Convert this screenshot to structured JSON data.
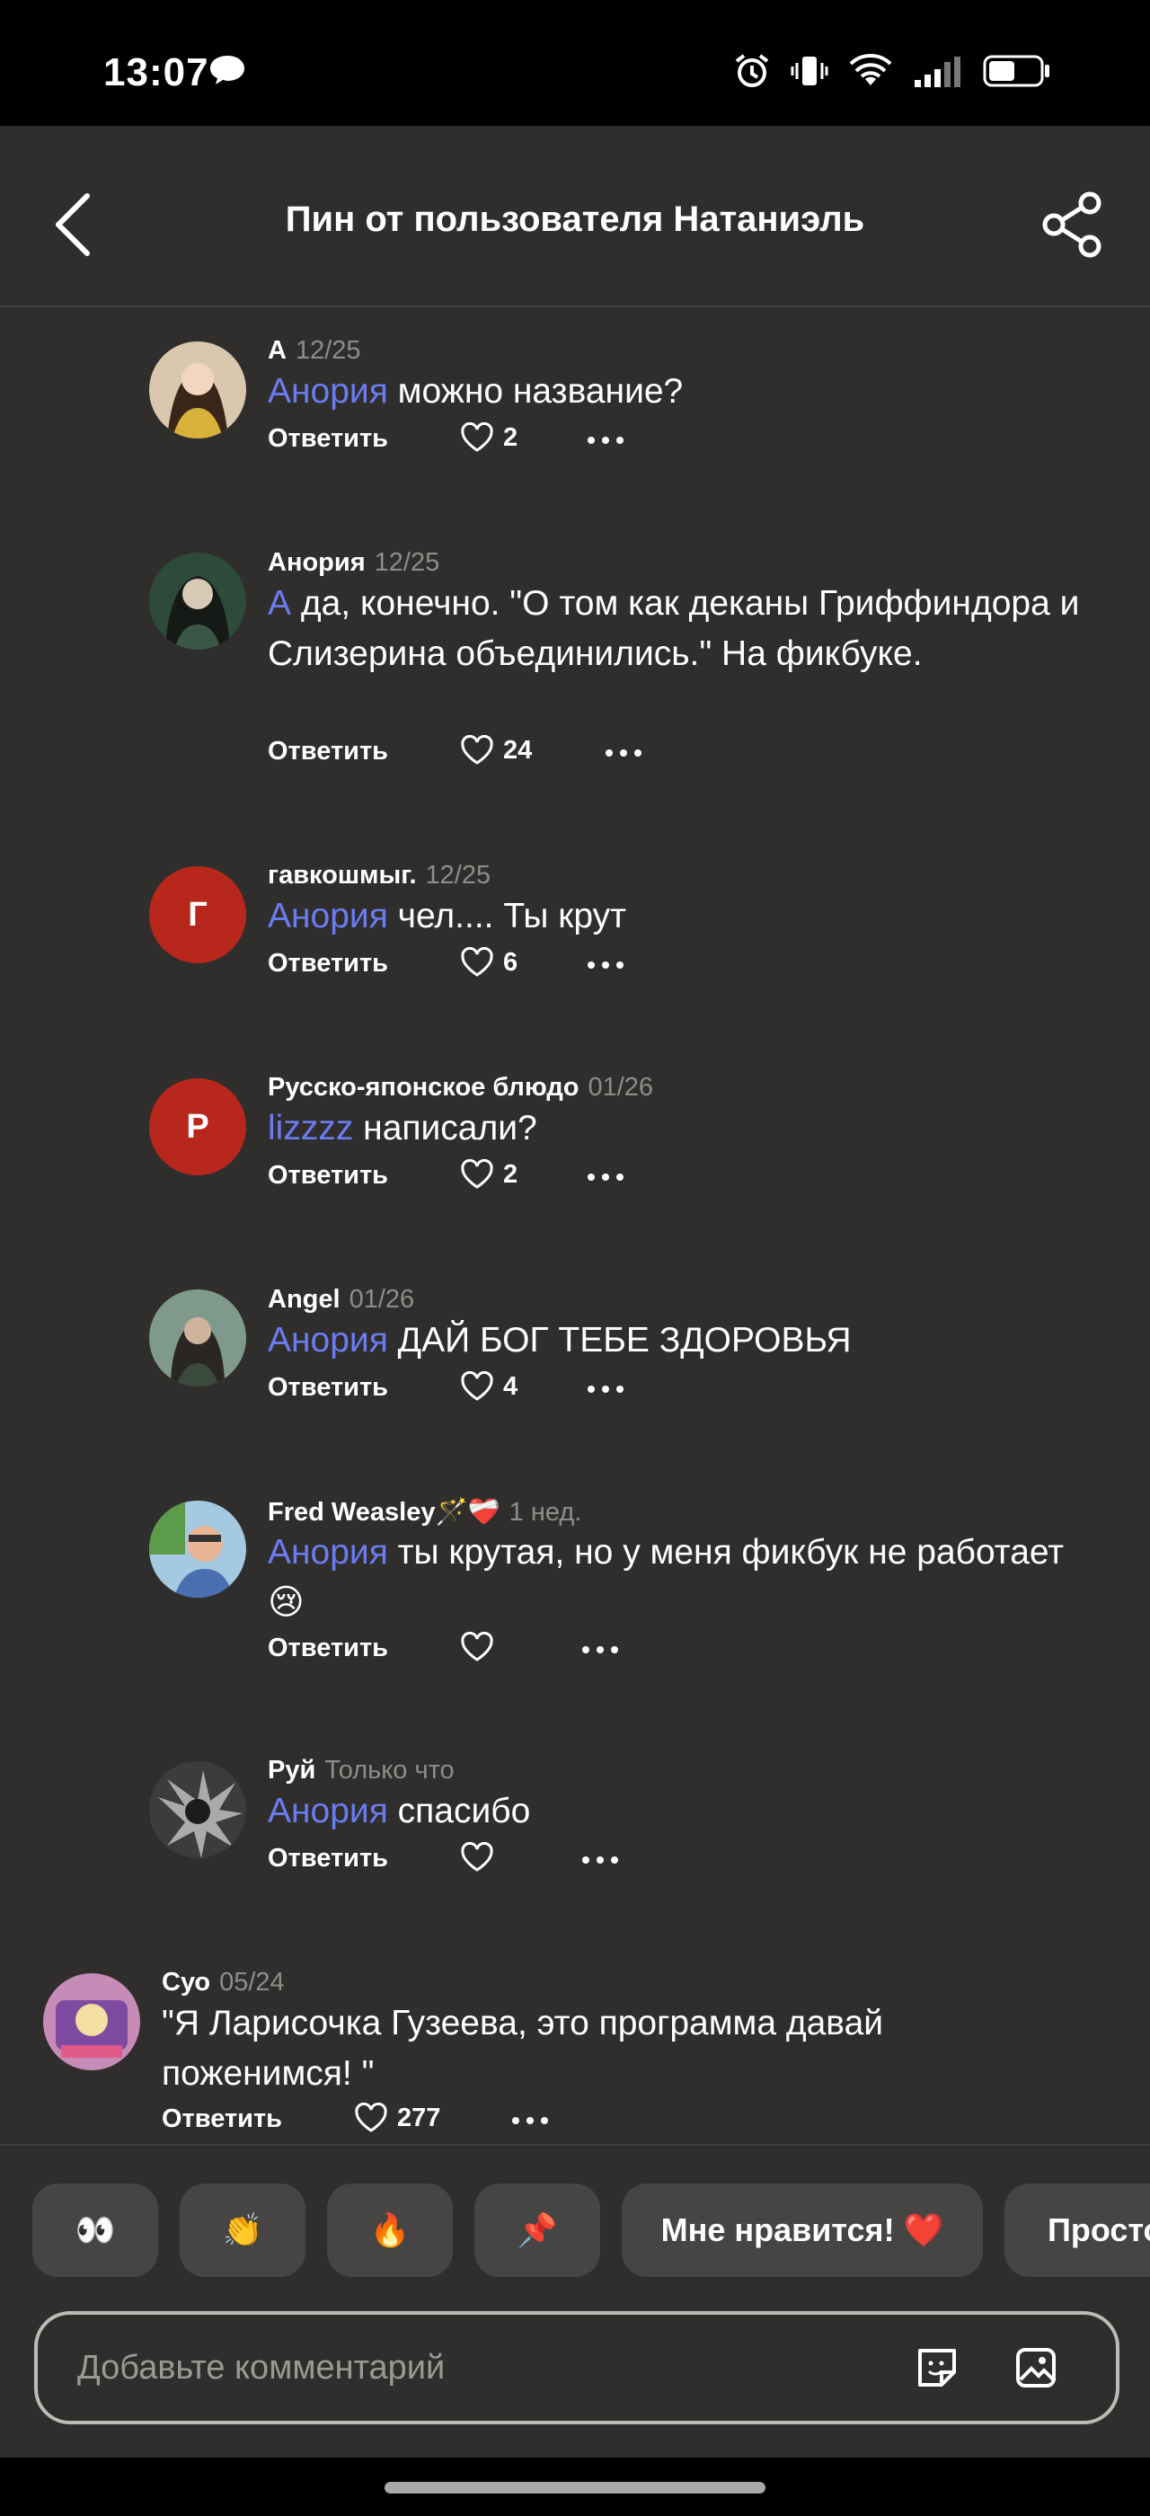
{
  "status_bar": {
    "time": "13:07"
  },
  "header": {
    "title": "Пин от пользователя Натаниэль"
  },
  "actions": {
    "reply_label": "Ответить"
  },
  "comments": [
    {
      "author": "А",
      "time": "12/25",
      "mention": "Анория",
      "text": " можно название?",
      "likes": "2"
    },
    {
      "author": "Анория",
      "time": "12/25",
      "mention": "А",
      "text": " да, конечно. \"О том как деканы Гриффиндора и Слизерина объединились.\" На фикбуке.",
      "likes": "24"
    },
    {
      "author": "гавкошмыг.",
      "time": "12/25",
      "mention": "Анория",
      "text": " чел.... Ты крут",
      "likes": "6",
      "avatar_letter": "Г"
    },
    {
      "author": "Русско-японское блюдо",
      "time": "01/26",
      "mention": "lizzzz",
      "text": " написали?",
      "likes": "2",
      "avatar_letter": "Р"
    },
    {
      "author": "Angel",
      "time": "01/26",
      "mention": "Анория",
      "text": " ДАЙ БОГ ТЕБЕ ЗДОРОВЬЯ",
      "likes": "4"
    },
    {
      "author": "Fred Weasley🪄❤️‍🩹",
      "time": "1 нед.",
      "mention": "Анория",
      "text": " ты крутая, но у меня фикбук не работает😢",
      "likes": ""
    },
    {
      "author": "Руй",
      "time": "Только что",
      "mention": "Анория",
      "text": " спасибо",
      "likes": ""
    },
    {
      "author": "Суо",
      "time": "05/24",
      "mention": "",
      "text": "\"Я Ларисочка Гузеева, это программа давай поженимся! \"",
      "likes": "277"
    }
  ],
  "reactions": [
    "👀",
    "👏",
    "🔥",
    "📌",
    "Мне нравится! ❤️",
    "Просто"
  ],
  "comment_input": {
    "placeholder": "Добавьте комментарий"
  },
  "colors": {
    "background": "#2f2e2c",
    "mention": "#6b7cf0",
    "avatar_red": "#b8271b"
  }
}
